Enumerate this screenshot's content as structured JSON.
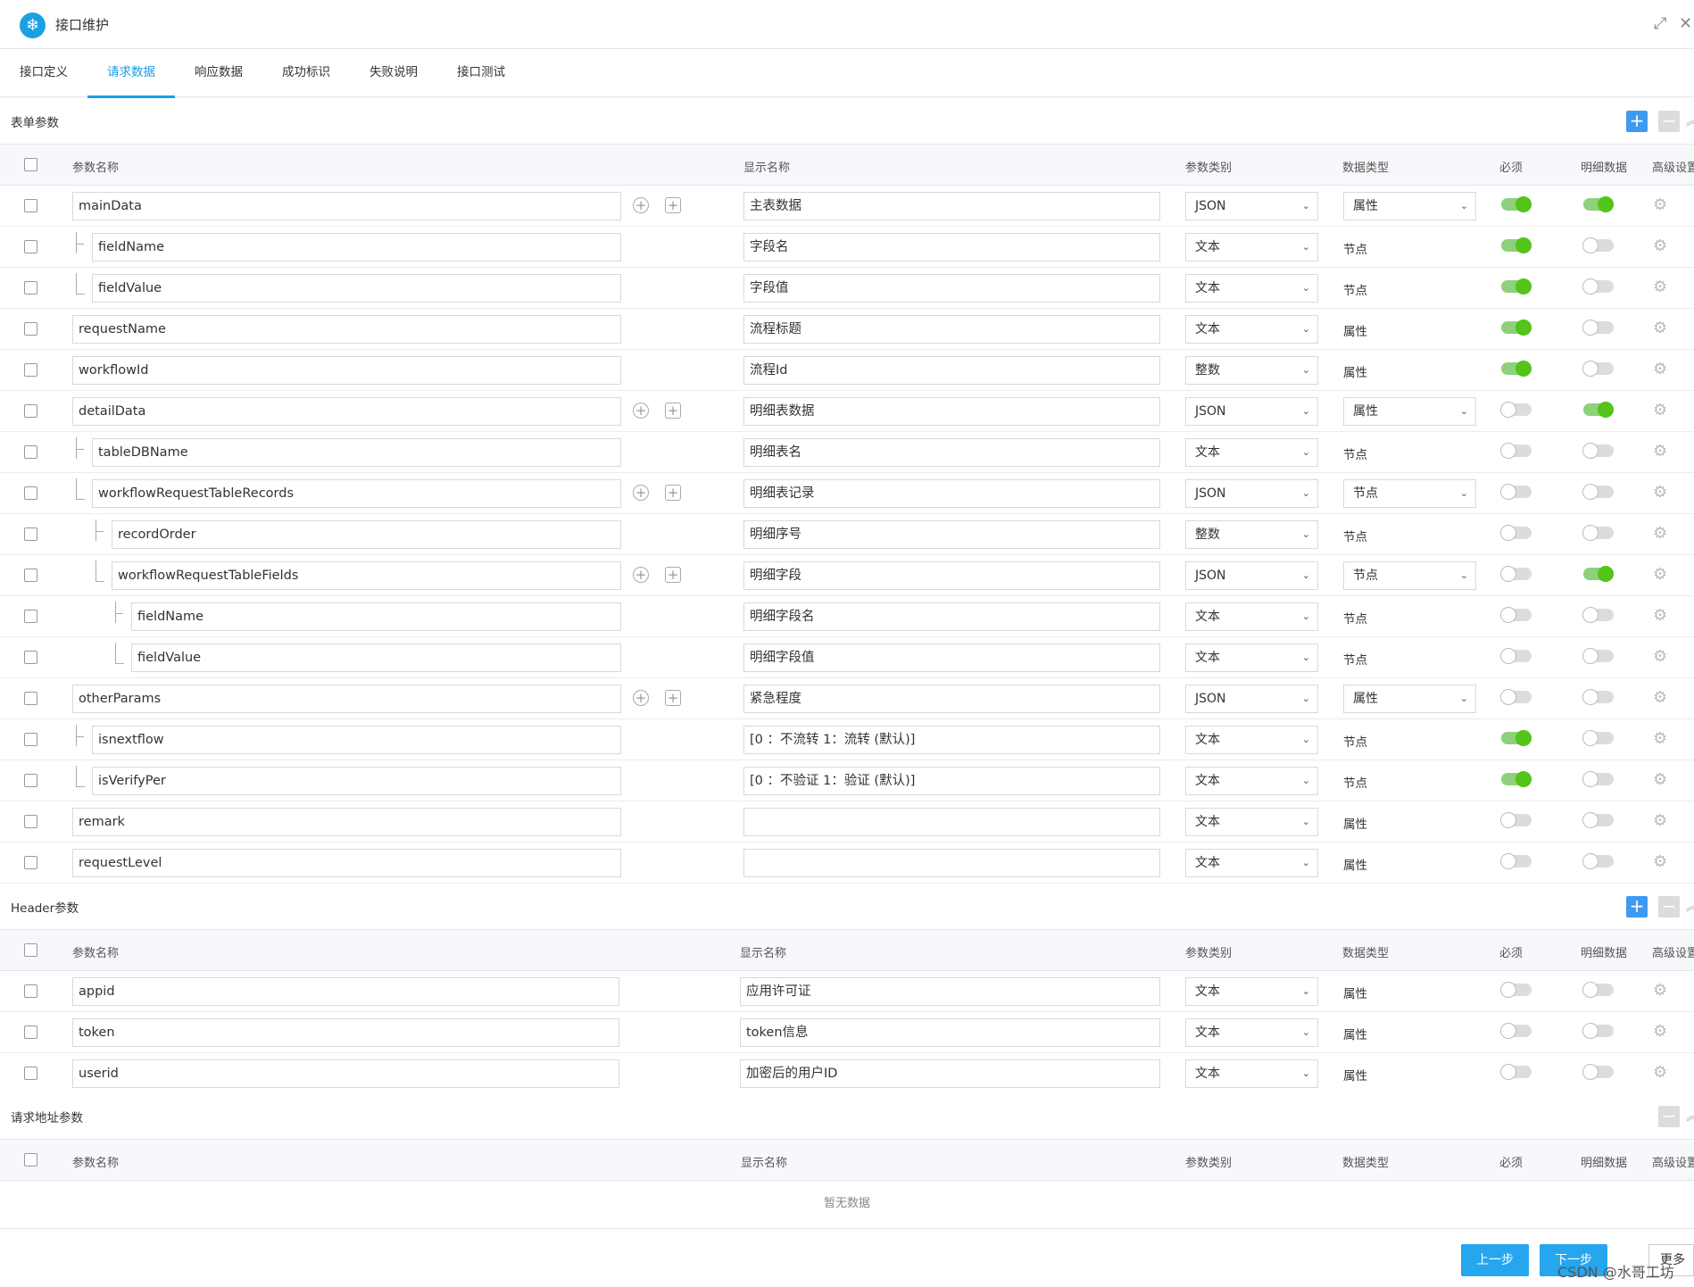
{
  "window": {
    "title": "接口维护"
  },
  "tabs": [
    {
      "label": "接口定义"
    },
    {
      "label": "请求数据"
    },
    {
      "label": "响应数据"
    },
    {
      "label": "成功标识"
    },
    {
      "label": "失败说明"
    },
    {
      "label": "接口测试"
    }
  ],
  "columns": {
    "name": "参数名称",
    "display": "显示名称",
    "category": "参数类别",
    "dtype": "数据类型",
    "required": "必须",
    "detail": "明细数据",
    "advanced": "高级设置"
  },
  "form_section": {
    "title": "表单参数",
    "rows": [
      {
        "name": "mainData",
        "display": "主表数据",
        "category": "JSON",
        "dtype": "属性",
        "dtype_select": true,
        "required": true,
        "detail": true
      },
      {
        "name": "fieldName",
        "display": "字段名",
        "category": "文本",
        "dtype": "节点",
        "required": true,
        "detail": false
      },
      {
        "name": "fieldValue",
        "display": "字段值",
        "category": "文本",
        "dtype": "节点",
        "required": true,
        "detail": false
      },
      {
        "name": "requestName",
        "display": "流程标题",
        "category": "文本",
        "dtype": "属性",
        "required": true,
        "detail": false
      },
      {
        "name": "workflowId",
        "display": "流程Id",
        "category": "整数",
        "dtype": "属性",
        "required": true,
        "detail": false
      },
      {
        "name": "detailData",
        "display": "明细表数据",
        "category": "JSON",
        "dtype": "属性",
        "dtype_select": true,
        "required": false,
        "detail": true
      },
      {
        "name": "tableDBName",
        "display": "明细表名",
        "category": "文本",
        "dtype": "节点",
        "required": false,
        "detail": false
      },
      {
        "name": "workflowRequestTableRecords",
        "display": "明细表记录",
        "category": "JSON",
        "dtype": "节点",
        "dtype_select": true,
        "required": false,
        "detail": false
      },
      {
        "name": "recordOrder",
        "display": "明细序号",
        "category": "整数",
        "dtype": "节点",
        "required": false,
        "detail": false
      },
      {
        "name": "workflowRequestTableFields",
        "display": "明细字段",
        "category": "JSON",
        "dtype": "节点",
        "dtype_select": true,
        "required": false,
        "detail": true
      },
      {
        "name": "fieldName",
        "display": "明细字段名",
        "category": "文本",
        "dtype": "节点",
        "required": false,
        "detail": false
      },
      {
        "name": "fieldValue",
        "display": "明细字段值",
        "category": "文本",
        "dtype": "节点",
        "required": false,
        "detail": false
      },
      {
        "name": "otherParams",
        "display": "紧急程度",
        "category": "JSON",
        "dtype": "属性",
        "dtype_select": true,
        "required": false,
        "detail": false
      },
      {
        "name": "isnextflow",
        "display": "[0 ：不流转 1：流转 (默认)]",
        "category": "文本",
        "dtype": "节点",
        "required": true,
        "detail": false
      },
      {
        "name": "isVerifyPer",
        "display": "[0 ：不验证 1：验证 (默认)]",
        "category": "文本",
        "dtype": "节点",
        "required": true,
        "detail": false
      },
      {
        "name": "remark",
        "display": "",
        "category": "文本",
        "dtype": "属性",
        "required": false,
        "detail": false
      },
      {
        "name": "requestLevel",
        "display": "",
        "category": "文本",
        "dtype": "属性",
        "required": false,
        "detail": false
      }
    ]
  },
  "header_section": {
    "title": "Header参数",
    "rows": [
      {
        "name": "appid",
        "display": "应用许可证",
        "category": "文本",
        "dtype": "属性",
        "required": false,
        "detail": false
      },
      {
        "name": "token",
        "display": "token信息",
        "category": "文本",
        "dtype": "属性",
        "required": false,
        "detail": false
      },
      {
        "name": "userid",
        "display": "加密后的用户ID",
        "category": "文本",
        "dtype": "属性",
        "required": false,
        "detail": false
      }
    ]
  },
  "url_section": {
    "title": "请求地址参数",
    "empty_text": "暂无数据"
  },
  "footer": {
    "prev": "上一步",
    "next": "下一步",
    "more": "更多",
    "watermark": "CSDN @水哥工坊"
  },
  "icons": {
    "logo": "snowflake-icon",
    "add": "plus-icon",
    "remove": "minus-icon",
    "settings": "gear-icon"
  },
  "colors": {
    "accent": "#1e9be8",
    "switch_on": "#52c41a"
  }
}
